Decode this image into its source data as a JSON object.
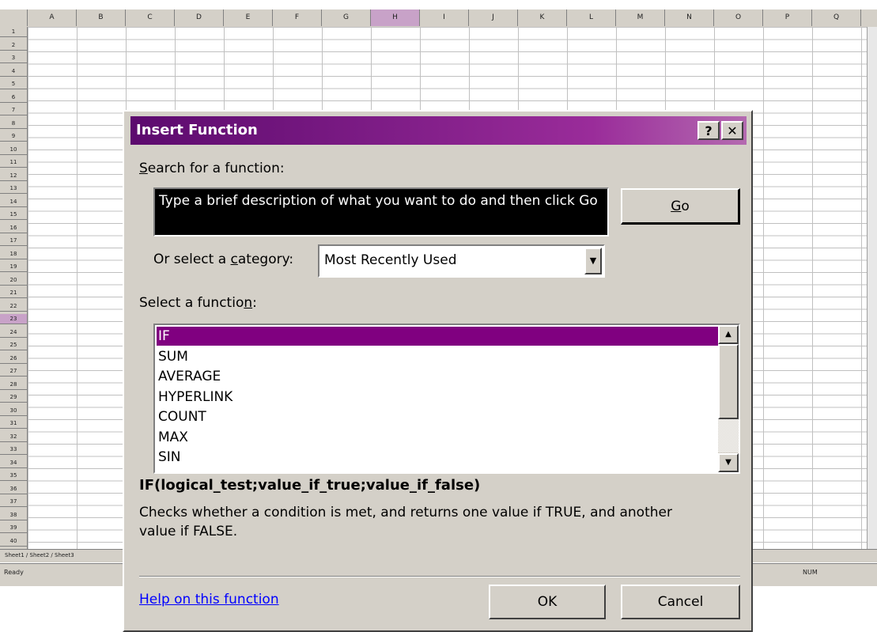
{
  "spreadsheet": {
    "columns": [
      "A",
      "B",
      "C",
      "D",
      "E",
      "F",
      "G",
      "H",
      "I",
      "J",
      "K",
      "L",
      "M",
      "N",
      "O",
      "P",
      "Q"
    ],
    "selected_column": "H",
    "rows": [
      "1",
      "2",
      "3",
      "4",
      "5",
      "6",
      "7",
      "8",
      "9",
      "10",
      "11",
      "12",
      "13",
      "14",
      "15",
      "16",
      "17",
      "18",
      "19",
      "20",
      "21",
      "22",
      "23",
      "24",
      "25",
      "26",
      "27",
      "28",
      "29",
      "30",
      "31",
      "32",
      "33",
      "34",
      "35",
      "36",
      "37",
      "38",
      "39",
      "40"
    ],
    "selected_row": "23",
    "sheet_tabs": "Sheet1 / Sheet2 / Sheet3",
    "status_left": "Ready",
    "status_right": "NUM"
  },
  "dialog": {
    "title": "Insert Function",
    "help_button": "?",
    "close_button": "✕",
    "search_label_accel": "S",
    "search_label_rest": "earch for a function:",
    "search_text": "Type a brief description of what you want to do and then click Go",
    "go_button_accel": "G",
    "go_button_rest": "o",
    "category_label_pre": "Or select a ",
    "category_label_accel": "c",
    "category_label_post": "ategory:",
    "category_value": "Most Recently Used",
    "function_label_pre": "Select a functio",
    "function_label_accel": "n",
    "function_label_post": ":",
    "functions": [
      "IF",
      "SUM",
      "AVERAGE",
      "HYPERLINK",
      "COUNT",
      "MAX",
      "SIN"
    ],
    "selected_function": "IF",
    "signature": "IF(logical_test;value_if_true;value_if_false)",
    "description": "Checks whether a condition is met, and returns one value if TRUE, and another value if FALSE.",
    "help_link": "Help on this function",
    "ok_button": "OK",
    "cancel_button": "Cancel"
  },
  "colors": {
    "title_gradient_start": "#5c0a6e",
    "selection": "#800080",
    "dialog_face": "#d4d0c8",
    "link": "#0000ff"
  }
}
